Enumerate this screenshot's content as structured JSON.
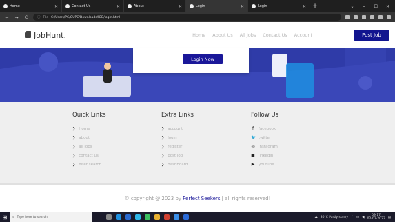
{
  "browser": {
    "tabs": [
      {
        "label": "Home",
        "active": false
      },
      {
        "label": "Contact Us",
        "active": false
      },
      {
        "label": "About",
        "active": false
      },
      {
        "label": "Login",
        "active": true
      },
      {
        "label": "Login",
        "active": false
      }
    ],
    "new_tab": "+",
    "url": "C:/Users/PC/OUPC/Downloads/IOB/login.html",
    "url_scheme": "File"
  },
  "header": {
    "brand": "JobHunt.",
    "menu": [
      "Home",
      "About Us",
      "All Jobs",
      "Contact Us",
      "Account"
    ],
    "post_job": "Post Job"
  },
  "hero": {
    "login_button": "Login Now"
  },
  "footer": {
    "quick_links": {
      "title": "Quick Links",
      "items": [
        "Home",
        "about",
        "all jobs",
        "contact us",
        "filter search"
      ]
    },
    "extra_links": {
      "title": "Extra Links",
      "items": [
        "account",
        "login",
        "register",
        "post job",
        "dashboard"
      ]
    },
    "follow_us": {
      "title": "Follow Us",
      "items": [
        {
          "label": "facebook",
          "icon": "facebook-icon",
          "glyph": "f"
        },
        {
          "label": "twitter",
          "icon": "twitter-icon",
          "glyph": "🐦"
        },
        {
          "label": "instagram",
          "icon": "instagram-icon",
          "glyph": "◎"
        },
        {
          "label": "linkedin",
          "icon": "linkedin-icon",
          "glyph": "▣"
        },
        {
          "label": "youtube",
          "icon": "youtube-icon",
          "glyph": "▶"
        }
      ]
    }
  },
  "copyright": {
    "prefix": "© copyright @ 2023 by",
    "brand": "Perfect Seekers",
    "suffix": "| all rights reserved!"
  },
  "taskbar": {
    "search_placeholder": "Type here to search",
    "weather": "30°C Partly sunny",
    "time": "09:17",
    "date": "02-02-2023"
  },
  "colors": {
    "accent": "#1a1799",
    "hero": "#2f3ba8",
    "footer_bg": "#efefef"
  }
}
